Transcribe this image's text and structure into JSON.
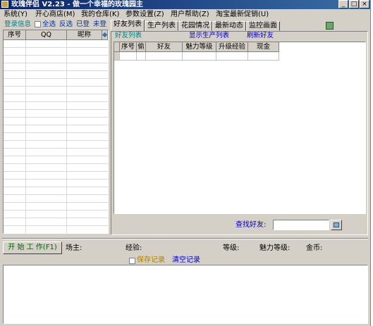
{
  "window": {
    "title": "玫瑰伴侣 V2.23 - 做一个幸福的玫瑰园主",
    "minimize_label": "_",
    "maximize_label": "□",
    "close_label": "×"
  },
  "menu": [
    {
      "label": "系统(Y)"
    },
    {
      "label": "开心商店(M)"
    },
    {
      "label": "我的仓库(K)"
    },
    {
      "label": "参数设置(Z)"
    },
    {
      "label": "用户帮助(Z)"
    },
    {
      "label": "淘宝最新促销(U)"
    }
  ],
  "left_toolbar": {
    "login_info": "登录信息",
    "select_all": "全选",
    "invert": "反选",
    "logged_in": "已登",
    "not_logged": "未登"
  },
  "left_grid": {
    "columns": [
      "序号",
      "QQ",
      "昵称"
    ]
  },
  "tabs": [
    {
      "label": "好友列表",
      "active": true
    },
    {
      "label": "生产列表",
      "active": false
    },
    {
      "label": "花园情况",
      "active": false
    },
    {
      "label": "最新动态",
      "active": false
    },
    {
      "label": "监控画面",
      "active": false
    }
  ],
  "friend_panel": {
    "group_label": "好友列表",
    "show_production_link": "显示生产列表",
    "refresh_link": "刷新好友",
    "columns": [
      "序号",
      "偷",
      "好友",
      "魅力等级",
      "升级经验",
      "现金"
    ],
    "search_label": "查找好友:",
    "search_value": ""
  },
  "status": {
    "start_button": "开 始 工 作(F1)",
    "owner_label": "场主:",
    "exp_label": "经验:",
    "level_label": "等级:",
    "charm_label": "魅力等级:",
    "gold_label": "金币:"
  },
  "log": {
    "save_record": "保存记录",
    "clear_record": "清空记录"
  }
}
